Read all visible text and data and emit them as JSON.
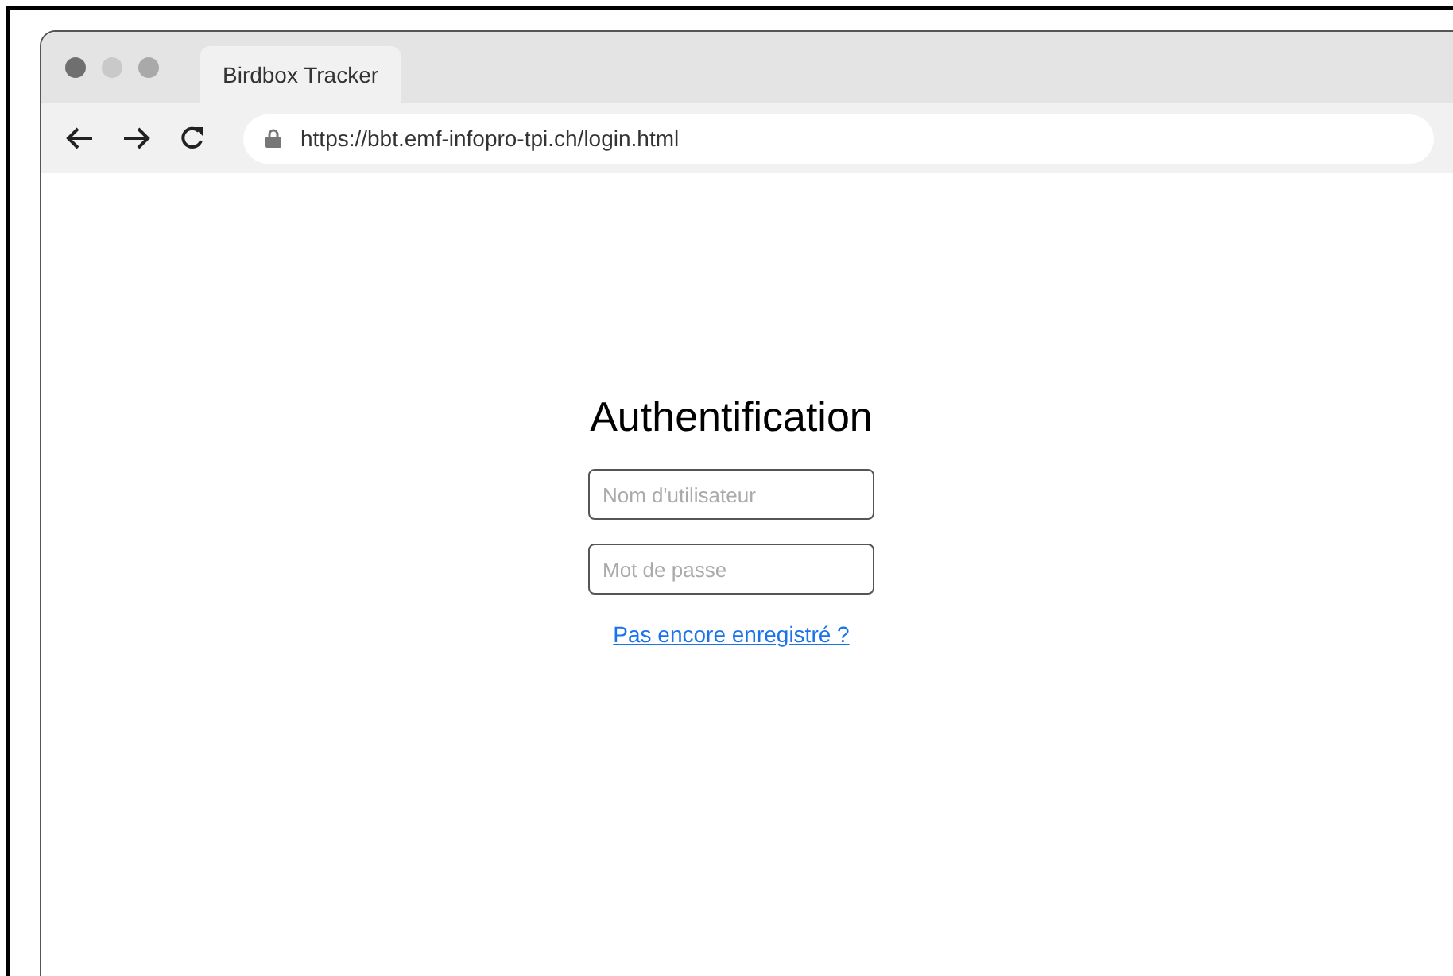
{
  "tab": {
    "title": "Birdbox Tracker",
    "selected": true
  },
  "address_bar": {
    "url": "https://bbt.emf-infopro-tpi.ch/login.html"
  },
  "login": {
    "heading": "Authentification",
    "fields": [
      {
        "placeholder": "Nom d'utilisateur"
      },
      {
        "placeholder": "Mot de passe"
      }
    ],
    "register_link": "Pas encore enregistré ?"
  }
}
